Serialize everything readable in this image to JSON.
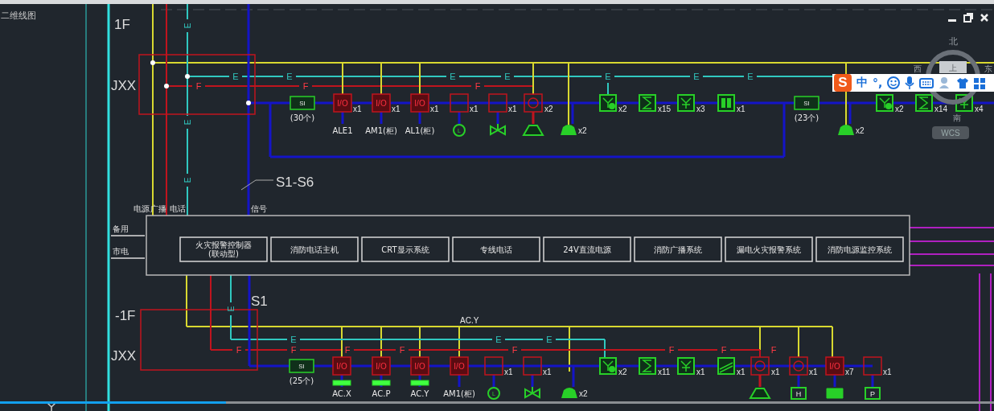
{
  "drawing_tab": {
    "title": "二维线图"
  },
  "window_controls": [
    {
      "kind": "minimize"
    },
    {
      "kind": "restore"
    },
    {
      "kind": "close"
    }
  ],
  "compass": {
    "north": "北",
    "west": "西",
    "east": "东",
    "center": "上",
    "south": "南"
  },
  "wcs_badge": "WCS",
  "ime_toolbar": {
    "logo": "S",
    "mode": "中",
    "punctuation": "°,"
  },
  "bus_labels": [
    "电源",
    "广播",
    "电话",
    "信号"
  ],
  "power_labels": [
    "备用",
    "市电"
  ],
  "control_modules": [
    "火灾报警控制器\n(联动型)",
    "消防电话主机",
    "CRT显示系统",
    "专线电话",
    "24V直流电源",
    "消防广播系统",
    "漏电火灾报警系统",
    "消防电源监控系统"
  ],
  "floors": [
    {
      "level": "1F",
      "cabinet": "JXX",
      "leader": "S1-S6",
      "markers": [
        {
          "kind": "e_vertical",
          "text": "E"
        },
        {
          "kind": "e_vertical",
          "text": "E"
        },
        {
          "kind": "e_vertical",
          "text": "E"
        },
        {
          "kind": "e",
          "text": "E"
        },
        {
          "kind": "e",
          "text": "E"
        },
        {
          "kind": "e",
          "text": "E"
        },
        {
          "kind": "e",
          "text": "E"
        },
        {
          "kind": "e",
          "text": "E"
        },
        {
          "kind": "e",
          "text": "E"
        },
        {
          "kind": "e",
          "text": "E"
        },
        {
          "kind": "f",
          "text": "F"
        },
        {
          "kind": "f",
          "text": "F"
        },
        {
          "kind": "f",
          "text": "F"
        }
      ],
      "devices": [
        {
          "kind": "panel",
          "text": "SI",
          "label": "(30个)"
        },
        {
          "kind": "module",
          "text": "I/O",
          "count": "x1",
          "label": "ALE1"
        },
        {
          "kind": "module",
          "text": "I/O",
          "count": "x1",
          "label": "AM1(柜)"
        },
        {
          "kind": "module",
          "text": "I/O",
          "count": "x1",
          "label": "AL1(柜)"
        },
        {
          "kind": "relay",
          "count": "x1",
          "accessory": {
            "kind": "level",
            "text": "L"
          }
        },
        {
          "kind": "relay",
          "count": "x1",
          "accessory": {
            "kind": "valve"
          }
        },
        {
          "kind": "siren",
          "count": "x2",
          "accessory": {
            "kind": "horn"
          }
        },
        {
          "kind": "bell",
          "count": "x2"
        },
        {
          "kind": "combo",
          "count": "x2"
        },
        {
          "kind": "smoke",
          "count": "x15"
        },
        {
          "kind": "heat",
          "count": "x3"
        },
        {
          "kind": "button",
          "count": "x1"
        },
        {
          "kind": "panel",
          "text": "SI",
          "label": "(23个)"
        },
        {
          "kind": "bell",
          "count": "x2"
        },
        {
          "kind": "combo",
          "count": "x2"
        },
        {
          "kind": "smoke",
          "count": "x14"
        },
        {
          "kind": "heat",
          "count": "x4"
        }
      ]
    },
    {
      "level": "-1F",
      "cabinet": "JXX",
      "leader": "S1",
      "bus_note": "AC.Y",
      "markers": [
        {
          "kind": "e_vertical",
          "text": "E"
        },
        {
          "kind": "e",
          "text": "E"
        },
        {
          "kind": "e",
          "text": "E"
        },
        {
          "kind": "e",
          "text": "E"
        },
        {
          "kind": "f",
          "text": "F"
        },
        {
          "kind": "f",
          "text": "F"
        },
        {
          "kind": "f",
          "text": "F"
        },
        {
          "kind": "f",
          "text": "F"
        },
        {
          "kind": "f",
          "text": "F"
        },
        {
          "kind": "f",
          "text": "F"
        },
        {
          "kind": "f",
          "text": "F"
        },
        {
          "kind": "f",
          "text": "F"
        }
      ],
      "devices": [
        {
          "kind": "panel",
          "text": "SI",
          "label": "(25个)"
        },
        {
          "kind": "module",
          "text": "I/O",
          "label": "AC.X",
          "accessory": {
            "kind": "bar"
          }
        },
        {
          "kind": "module",
          "text": "I/O",
          "label": "AC.P",
          "accessory": {
            "kind": "bar"
          }
        },
        {
          "kind": "module",
          "text": "I/O",
          "label": "AC.Y",
          "accessory": {
            "kind": "bar"
          }
        },
        {
          "kind": "module",
          "text": "I/O",
          "label": "AM1(柜)"
        },
        {
          "kind": "relay",
          "count": "x1",
          "accessory": {
            "kind": "level",
            "text": "L"
          }
        },
        {
          "kind": "relay",
          "count": "x1",
          "accessory": {
            "kind": "valve"
          }
        },
        {
          "kind": "bell",
          "count": "x2"
        },
        {
          "kind": "combo",
          "count": "x2"
        },
        {
          "kind": "smoke",
          "count": "x11"
        },
        {
          "kind": "heat",
          "count": "x1"
        },
        {
          "kind": "damper",
          "count": "x1"
        },
        {
          "kind": "siren",
          "count": "x1",
          "accessory": {
            "kind": "horn"
          }
        },
        {
          "kind": "siren",
          "count": "x1",
          "accessory": {
            "kind": "box",
            "text": "H"
          }
        },
        {
          "kind": "module",
          "text": "I/O",
          "count": "x7",
          "accessory": {
            "kind": "fan"
          }
        },
        {
          "kind": "relay",
          "count": "x1",
          "accessory": {
            "kind": "box",
            "text": "P"
          }
        }
      ]
    }
  ],
  "playback": {
    "level": 0.227
  }
}
